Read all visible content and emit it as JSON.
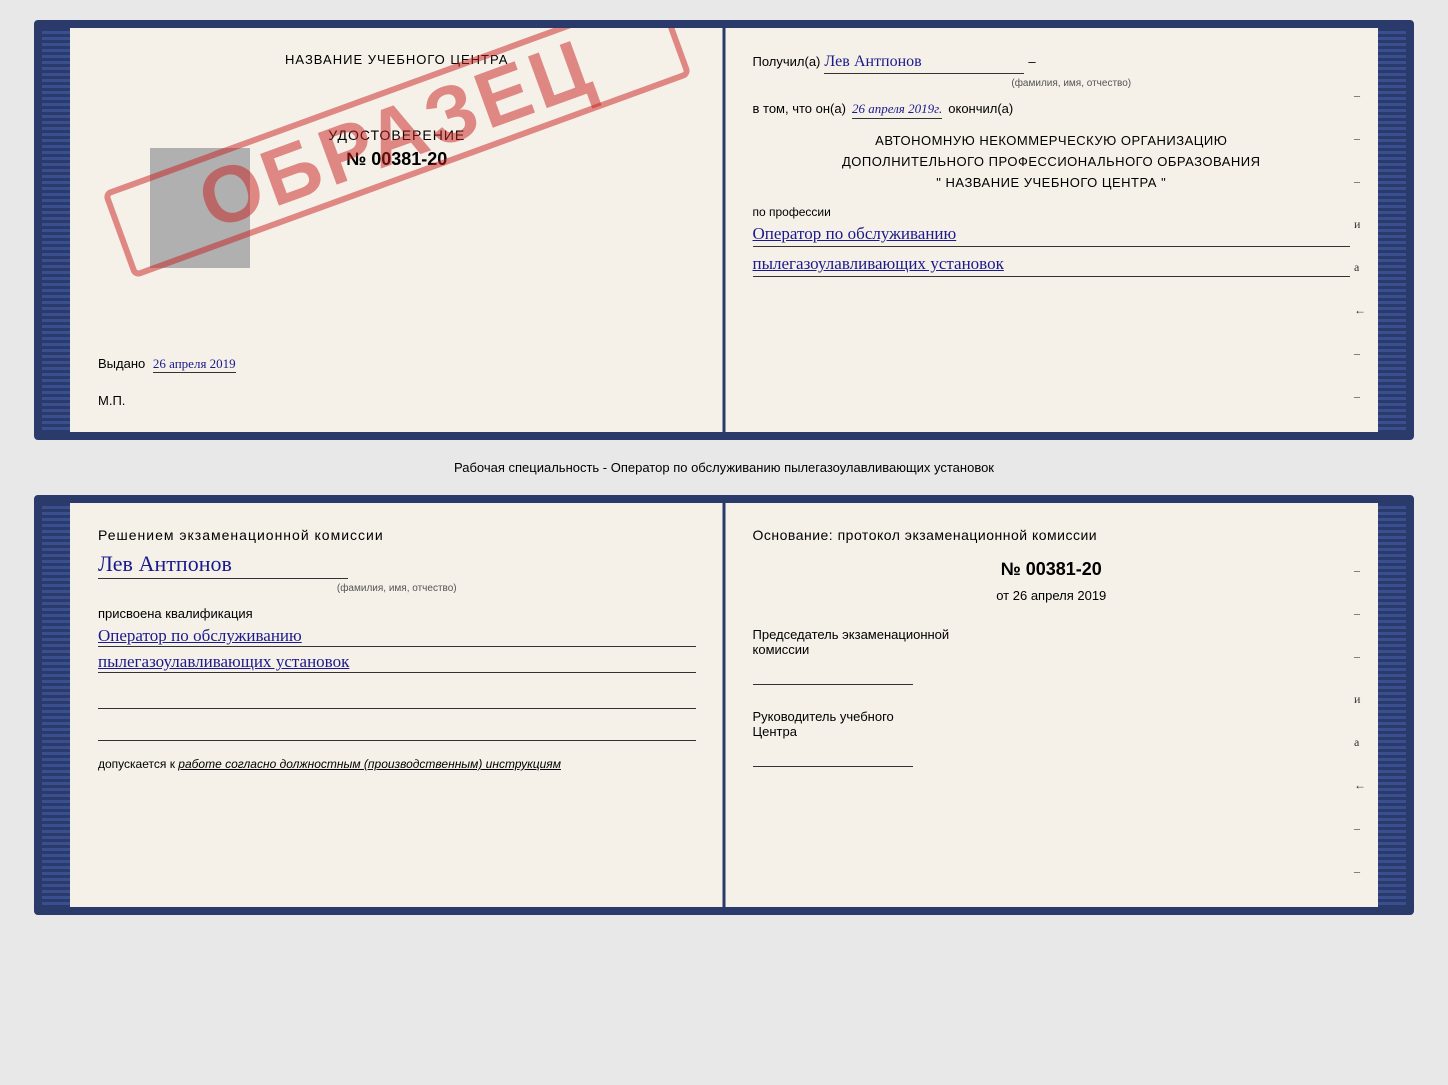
{
  "page": {
    "background": "#e8e8e8"
  },
  "top_book": {
    "left_page": {
      "training_center": "НАЗВАНИЕ УЧЕБНОГО ЦЕНТРА",
      "udostoverenie_label": "УДОСТОВЕРЕНИЕ",
      "cert_number": "№ 00381-20",
      "obrazec": "ОБРАЗЕЦ",
      "issued_label": "Выдано",
      "issued_date": "26 апреля 2019",
      "mp_label": "М.П."
    },
    "right_page": {
      "poluchil_label": "Получил(а)",
      "poluchil_name": "Лев Антпонов",
      "fio_label": "(фамилия, имя, отчество)",
      "vtom_label": "в том, что он(а)",
      "vtom_date": "26 апреля 2019г.",
      "okoncil_label": "окончил(а)",
      "org_line1": "АВТОНОМНУЮ НЕКОММЕРЧЕСКУЮ ОРГАНИЗАЦИЮ",
      "org_line2": "ДОПОЛНИТЕЛЬНОГО ПРОФЕССИОНАЛЬНОГО ОБРАЗОВАНИЯ",
      "org_quote1": "\"",
      "org_name": "НАЗВАНИЕ УЧЕБНОГО ЦЕНТРА",
      "org_quote2": "\"",
      "po_professii": "по профессии",
      "profession1": "Оператор по обслуживанию",
      "profession2": "пылегазоулавливающих установок",
      "dashes": [
        "-",
        "-",
        "-",
        "и",
        "а",
        "←",
        "-",
        "-",
        "-",
        "-"
      ]
    }
  },
  "middle_label": "Рабочая специальность - Оператор по обслуживанию пылегазоулавливающих установок",
  "bottom_book": {
    "left_page": {
      "resheniem_label": "Решением экзаменационной комиссии",
      "person_name": "Лев Антпонов",
      "fio_label": "(фамилия, имя, отчество)",
      "prisvoena_label": "присвоена квалификация",
      "kvalif1": "Оператор по обслуживанию",
      "kvalif2": "пылегазоулавливающих установок",
      "dopuskaetsya_label": "допускается к",
      "dopuskaetsya_text": "работе согласно должностным (производственным) инструкциям"
    },
    "right_page": {
      "osnovanie_label": "Основание: протокол экзаменационной комиссии",
      "protocol_number": "№ 00381-20",
      "ot_prefix": "от",
      "ot_date": "26 апреля 2019",
      "predsedatel_label": "Председатель экзаменационной",
      "predsedatel_label2": "комиссии",
      "rukovoditel_label": "Руководитель учебного",
      "rukovoditel_label2": "Центра",
      "dashes": [
        "-",
        "-",
        "-",
        "и",
        "а",
        "←",
        "-",
        "-",
        "-",
        "-"
      ]
    }
  }
}
